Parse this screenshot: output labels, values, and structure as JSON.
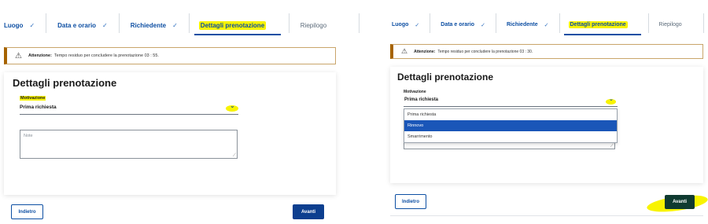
{
  "left": {
    "steps": [
      {
        "label": "Luogo",
        "check": "✓"
      },
      {
        "label": "Data e orario",
        "check": "✓"
      },
      {
        "label": "Richiedente",
        "check": "✓"
      },
      {
        "label": "Dettagli prenotazione"
      },
      {
        "label": "Riepilogo"
      }
    ],
    "warning": {
      "icon": "warning-triangle-icon",
      "title": "Attenzione:",
      "text": "Tempo residuo per concludere la prenotazione 03 : 55."
    },
    "card": {
      "title": "Dettagli prenotazione",
      "field_label": "Motivazione",
      "select_value": "Prima richiesta",
      "chevron": "⌄",
      "note_placeholder": "Note"
    },
    "buttons": {
      "back": "Indietro",
      "next": "Avanti"
    }
  },
  "right": {
    "steps": [
      {
        "label": "Luogo",
        "check": "✓"
      },
      {
        "label": "Data e orario",
        "check": "✓"
      },
      {
        "label": "Richiedente",
        "check": "✓"
      },
      {
        "label": "Dettagli prenotazione"
      },
      {
        "label": "Riepilogo"
      }
    ],
    "warning": {
      "icon": "warning-triangle-icon",
      "title": "Attenzione:",
      "text": "Tempo residuo per concludere la prenotazione 03 : 30."
    },
    "card": {
      "title": "Dettagli prenotazione",
      "field_label": "Motivazione",
      "select_value": "Prima richiesta",
      "chevron": "⌄",
      "options": [
        "Prima richiesta",
        "Rinnovo",
        "Smarrimento"
      ],
      "selected_option": "Rinnovo"
    },
    "buttons": {
      "back": "Indietro",
      "next": "Avanti"
    }
  },
  "colors": {
    "accent": "#0d4fa3",
    "highlight": "#f8f300",
    "warning_border": "#a66300",
    "selected_option_bg": "#1a56b8"
  }
}
